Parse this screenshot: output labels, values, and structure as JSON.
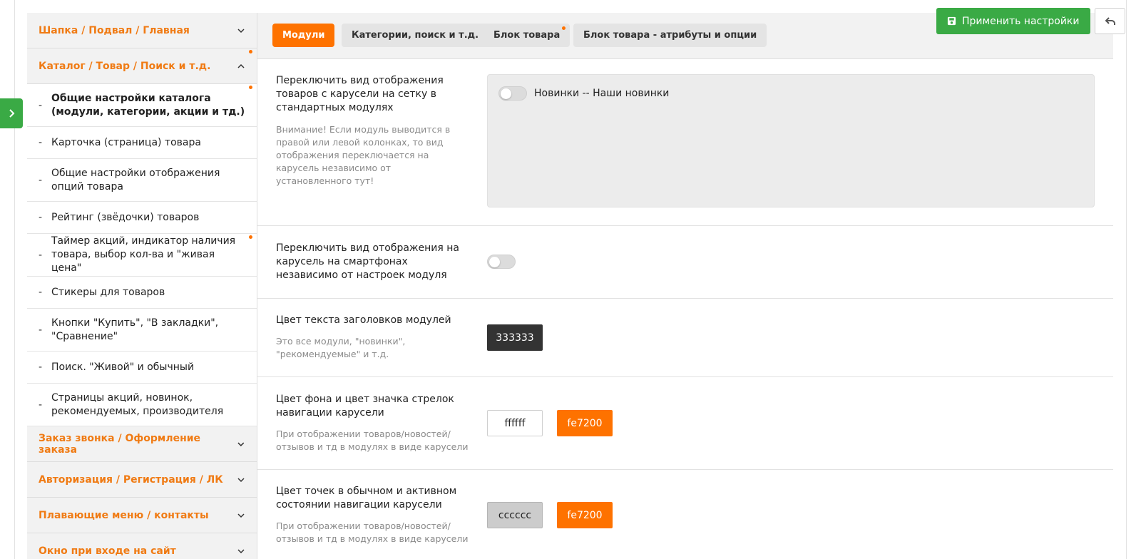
{
  "sidebar": {
    "sections_top": [
      {
        "label": "Шапка / Подвал / Главная"
      },
      {
        "label": "Каталог / Товар / Поиск и т.д."
      }
    ],
    "sub_items": [
      {
        "label": "Общие настройки каталога (модули, категории, акции и тд.)"
      },
      {
        "label": "Карточка (страница) товара"
      },
      {
        "label": "Общие настройки отображения опций товара"
      },
      {
        "label": "Рейтинг (звёдочки) товаров"
      },
      {
        "label": "Таймер акций, индикатор наличия товара, выбор кол-ва и \"живая цена\""
      },
      {
        "label": "Стикеры для товаров"
      },
      {
        "label": "Кнопки \"Купить\", \"В закладки\", \"Сравнение\""
      },
      {
        "label": "Поиск. \"Живой\" и обычный"
      },
      {
        "label": "Страницы акций, новинок, рекомендуемых, производителя"
      }
    ],
    "sections_bottom": [
      {
        "label": "Заказ звонка / Оформление заказа"
      },
      {
        "label": "Авторизация / Регистрация / ЛК"
      },
      {
        "label": "Плавающие меню / контакты"
      },
      {
        "label": "Окно при входе на сайт"
      }
    ],
    "dash": "-"
  },
  "tabs": [
    {
      "label": "Модули"
    },
    {
      "label": "Категории, поиск и т.д."
    },
    {
      "label": "Блок товара"
    },
    {
      "label": "Блок товара - атрибуты и опции"
    }
  ],
  "toolbar": {
    "apply_label": "Применить настройки"
  },
  "settings": {
    "carousel_grid": {
      "label": "Переключить вид отображения товаров с карусели на сетку в стандартных модулях",
      "hint": "Внимание! Если модуль выводится в правой или левой колонках, то вид отображения переключается на карусель независимо от установленного тут!",
      "module": "Новинки  --  Наши новинки"
    },
    "mobile_carousel": {
      "label": "Переключить вид отображения на карусель на смартфонах независимо от настроек модуля"
    },
    "heading_color": {
      "label": "Цвет текста заголовков модулей",
      "hint": "Это все модули, \"новинки\", \"рекомендуемые\" и т.д.",
      "value": "333333"
    },
    "arrows_color": {
      "label": "Цвет фона и цвет значка стрелок навигации карусели",
      "hint": "При отображении товаров/новостей/отзывов и тд в модулях в виде карусели",
      "bg": "ffffff",
      "icon": "fe7200"
    },
    "dots_color": {
      "label": "Цвет точек в обычном и активном состоянии навигации карусели",
      "hint": "При отображении товаров/новостей/отзывов и тд в модулях в виде карусели",
      "normal": "cccccc",
      "active": "fe7200"
    }
  },
  "colors": {
    "accent": "#fe7200",
    "green": "#3aaa45",
    "swatch_333333": "#333333",
    "swatch_ffffff": "#ffffff",
    "swatch_cccccc": "#cccccc"
  }
}
